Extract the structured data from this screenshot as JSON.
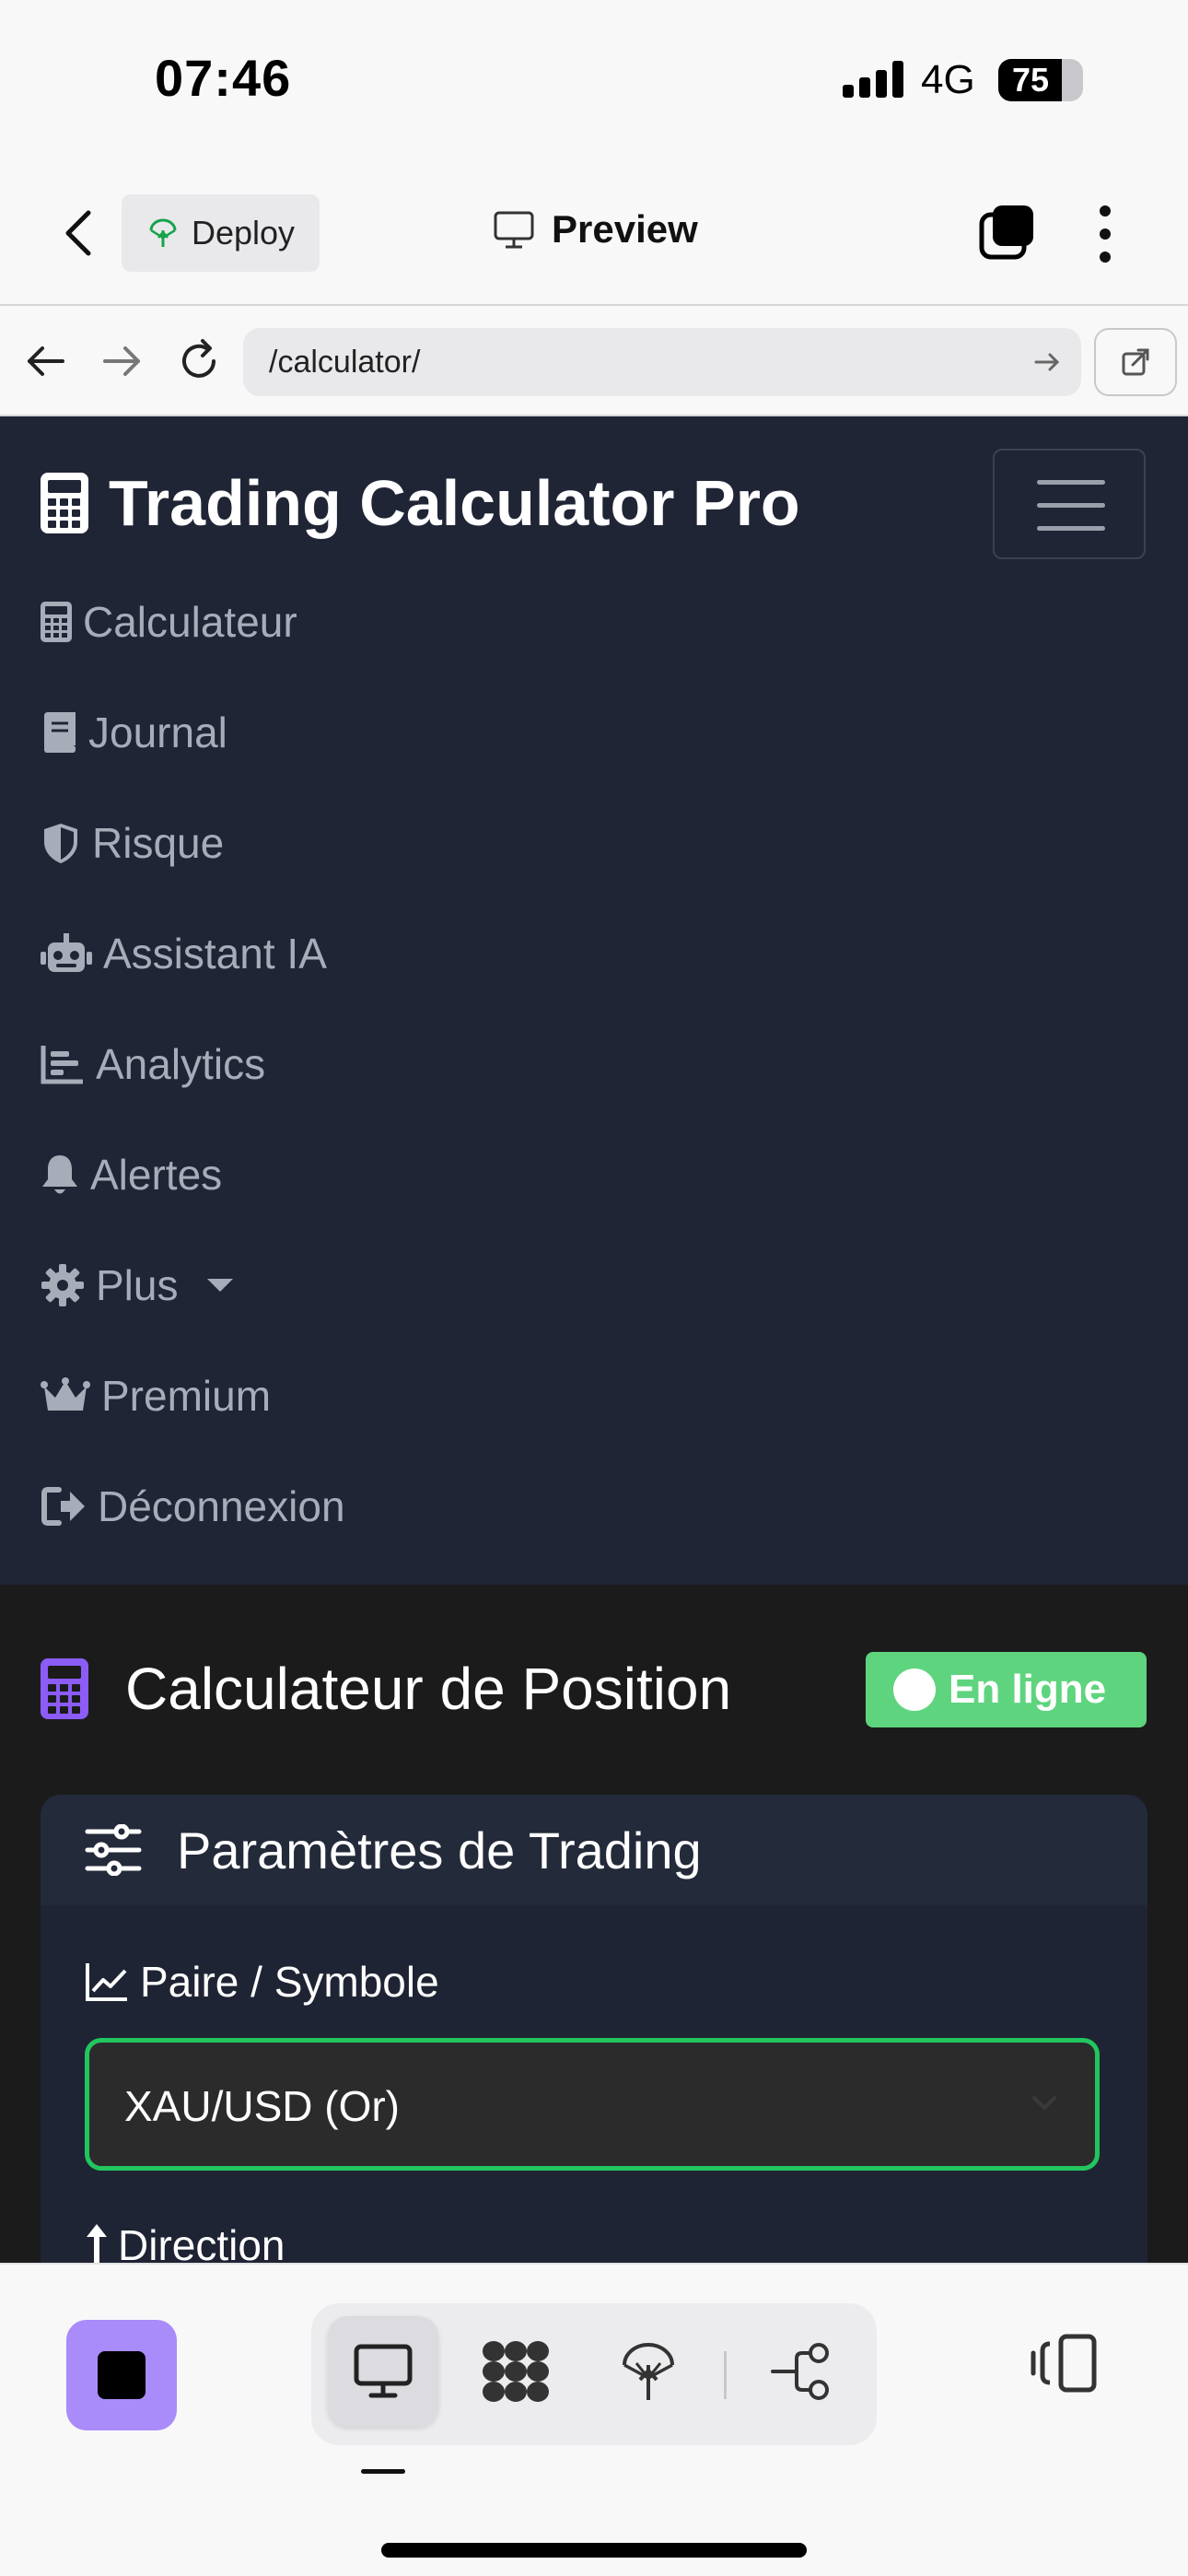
{
  "status_bar": {
    "time": "07:46",
    "network": "4G",
    "battery": "75",
    "battery_level": 0.75
  },
  "app_header": {
    "deploy_label": "Deploy",
    "preview_label": "Preview"
  },
  "address_bar": {
    "url": "/calculator/"
  },
  "navbar": {
    "brand": "Trading Calculator Pro",
    "items": [
      {
        "label": "Calculateur",
        "icon": "calculator-icon"
      },
      {
        "label": "Journal",
        "icon": "book-icon"
      },
      {
        "label": "Risque",
        "icon": "shield-icon"
      },
      {
        "label": "Assistant IA",
        "icon": "robot-icon"
      },
      {
        "label": "Analytics",
        "icon": "chart-bar-icon"
      },
      {
        "label": "Alertes",
        "icon": "bell-icon"
      },
      {
        "label": "Plus",
        "icon": "gear-icon"
      },
      {
        "label": "Premium",
        "icon": "crown-icon"
      },
      {
        "label": "Déconnexion",
        "icon": "logout-icon"
      }
    ]
  },
  "main": {
    "title": "Calculateur de Position",
    "status": "En ligne",
    "card_title": "Paramètres de Trading",
    "symbol_label": "Paire / Symbole",
    "symbol_value": "XAU/USD (Or)",
    "direction_label": "Direction"
  },
  "colors": {
    "navbar_bg": "#1f2535",
    "content_bg": "#1b1b1c",
    "card_bg": "#1e2433",
    "accent_purple": "#8b5cf6",
    "status_green": "#5fd47e",
    "select_border": "#22c55e",
    "stop_button": "#a98bfa"
  }
}
